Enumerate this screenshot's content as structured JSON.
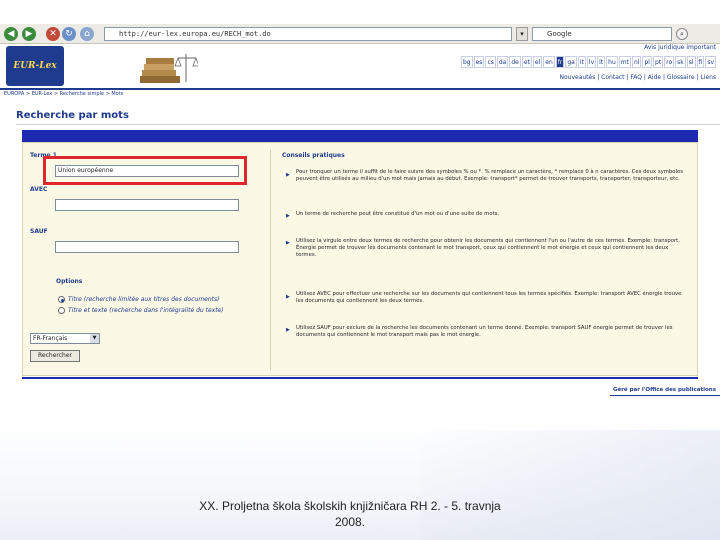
{
  "browser": {
    "url": "http://eur-lex.europa.eu/RECH_mot.do",
    "search_engine": "Google"
  },
  "header": {
    "logo_text": "EUR-Lex",
    "top_links": "Avis juridique important",
    "languages": [
      "bg",
      "es",
      "cs",
      "da",
      "de",
      "et",
      "el",
      "en",
      "fr",
      "ga",
      "it",
      "lv",
      "lt",
      "hu",
      "mt",
      "nl",
      "pl",
      "pt",
      "ro",
      "sk",
      "sl",
      "fi",
      "sv"
    ],
    "active_language": "fr",
    "nav": "Nouveautés | Contact | FAQ | Aide | Glossaire | Liens"
  },
  "breadcrumb": "EUROPA > EUR-Lex > Recherche simple > Mots",
  "page_title": "Recherche par mots",
  "form": {
    "field1_label": "Terme 1",
    "field1_value": "Union européenne",
    "field2_label": "AVEC",
    "field2_value": "",
    "field3_label": "SAUF",
    "field3_value": "",
    "options_label": "Options",
    "option1": "Titre (recherche limitée aux titres des documents)",
    "option2": "Titre et texte (recherche dans l'intégralité du texte)",
    "language_select": "FR-Français",
    "submit_label": "Rechercher"
  },
  "tips": {
    "title": "Conseils pratiques",
    "items": [
      "Pour tronquer un terme il suffit de le faire suivre des symboles % ou *. % remplace un caractère, * remplace 0 à n caractères. Ces deux symboles peuvent être utilisés au milieu d'un mot mais jamais au début. Exemple: transport* permet de trouver transports, transporter, transporteur, etc.",
      "Un terme de recherche peut être constitué d'un mot ou d'une suite de mots.",
      "Utilisez la virgule entre deux termes de recherche pour obtenir les documents qui contiennent l'un ou l'autre de ces termes. Exemple: transport, Énergie permet de trouver les documents contenant le mot transport, ceux qui contiennent le mot énergie et ceux qui contiennent les deux termes.",
      "Utilisez AVEC pour effectuer une recherche sur les documents qui contiennent tous les termes spécifiés. Exemple: transport AVEC énergie trouve les documents qui contiennent les deux termes.",
      "Utilisez SAUF pour exclure de la recherche les documents contenant un terme donné. Exemple: transport SAUF énergie permet de trouver les documents qui contiennent le mot transport mais pas le mot énergie."
    ]
  },
  "footer_link": "Géré par l'Office des publications",
  "slide": {
    "caption": "XX. Proljetna škola školskih knjižničara RH 2. - 5. travnja 2008."
  }
}
